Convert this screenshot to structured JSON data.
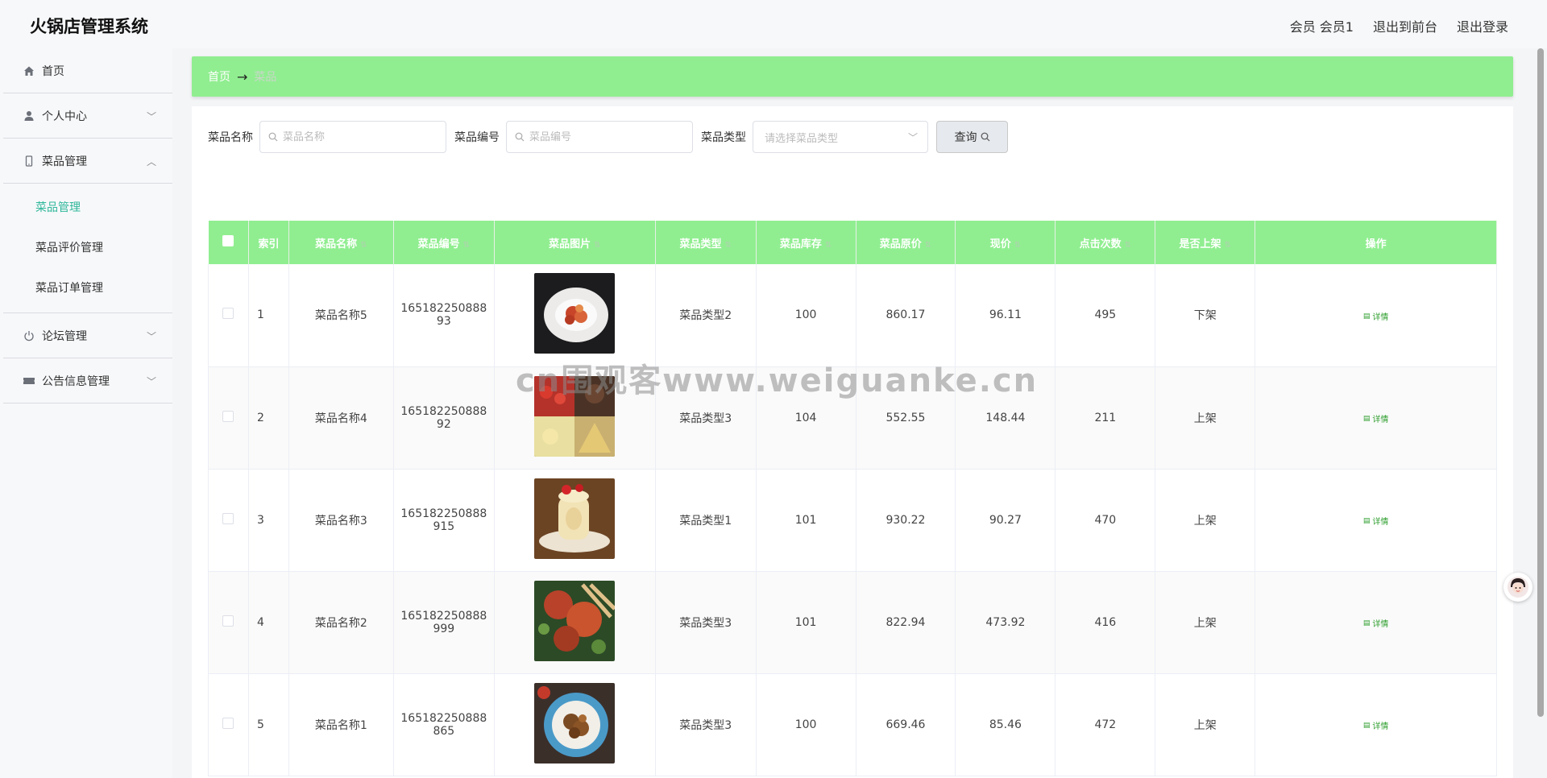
{
  "header": {
    "title": "火锅店管理系统",
    "member": "会员 会员1",
    "to_front": "退出到前台",
    "logout": "退出登录"
  },
  "sidebar": {
    "items": [
      {
        "label": "首页",
        "icon": "home-icon"
      },
      {
        "label": "个人中心",
        "icon": "user-icon"
      },
      {
        "label": "菜品管理",
        "icon": "phone-icon",
        "expanded": true,
        "children": [
          {
            "label": "菜品管理",
            "active": true
          },
          {
            "label": "菜品评价管理"
          },
          {
            "label": "菜品订单管理"
          }
        ]
      },
      {
        "label": "论坛管理",
        "icon": "power-icon"
      },
      {
        "label": "公告信息管理",
        "icon": "ticket-icon"
      }
    ]
  },
  "breadcrumb": {
    "home": "首页",
    "arrow": "→",
    "current": "菜品"
  },
  "search": {
    "name_label": "菜品名称",
    "name_placeholder": "菜品名称",
    "code_label": "菜品编号",
    "code_placeholder": "菜品编号",
    "type_label": "菜品类型",
    "type_placeholder": "请选择菜品类型",
    "query_label": "查询"
  },
  "table": {
    "headers": [
      "索引",
      "菜品名称",
      "菜品编号",
      "菜品图片",
      "菜品类型",
      "菜品库存",
      "菜品原价",
      "现价",
      "点击次数",
      "是否上架",
      "操作"
    ],
    "detail_label": "详情",
    "rows": [
      {
        "index": "1",
        "name": "菜品名称5",
        "code1": "165182250888",
        "code2": "93",
        "type": "菜品类型2",
        "stock": "100",
        "price": "860.17",
        "now": "96.11",
        "clicks": "495",
        "status": "下架"
      },
      {
        "index": "2",
        "name": "菜品名称4",
        "code1": "165182250888",
        "code2": "92",
        "type": "菜品类型3",
        "stock": "104",
        "price": "552.55",
        "now": "148.44",
        "clicks": "211",
        "status": "上架"
      },
      {
        "index": "3",
        "name": "菜品名称3",
        "code1": "165182250888",
        "code2": "915",
        "type": "菜品类型1",
        "stock": "101",
        "price": "930.22",
        "now": "90.27",
        "clicks": "470",
        "status": "上架"
      },
      {
        "index": "4",
        "name": "菜品名称2",
        "code1": "165182250888",
        "code2": "999",
        "type": "菜品类型3",
        "stock": "101",
        "price": "822.94",
        "now": "473.92",
        "clicks": "416",
        "status": "上架"
      },
      {
        "index": "5",
        "name": "菜品名称1",
        "code1": "165182250888",
        "code2": "865",
        "type": "菜品类型3",
        "stock": "100",
        "price": "669.46",
        "now": "85.46",
        "clicks": "472",
        "status": "上架"
      }
    ]
  },
  "watermark": "cn围观客www.weiguanke.cn",
  "colors": {
    "accent": "#90ee90",
    "active": "#2fb79a",
    "detail": "#2e9e2e"
  }
}
